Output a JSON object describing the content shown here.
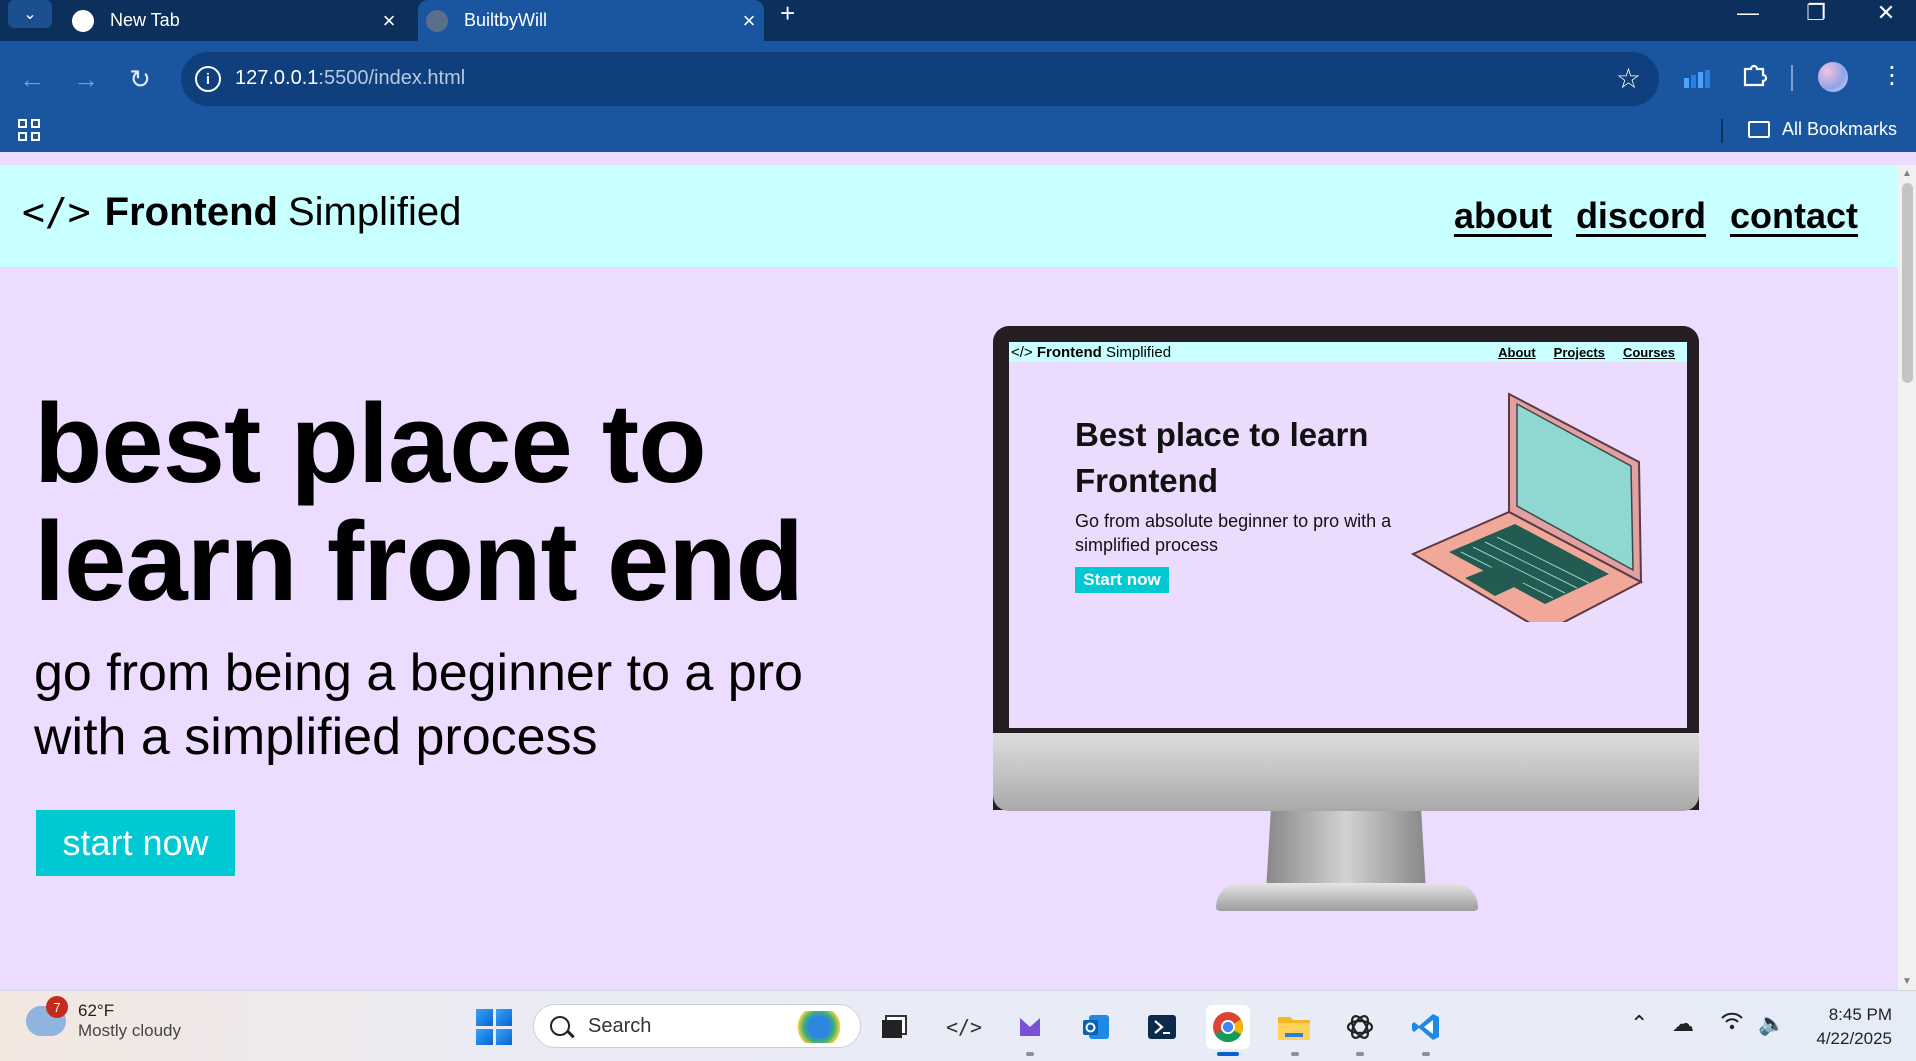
{
  "browser": {
    "tabs": [
      {
        "title": "New Tab"
      },
      {
        "title": "BuiltbyWill"
      }
    ],
    "url_host": "127.0.0.1",
    "url_path": ":5500/index.html",
    "bookmarks_label": "All Bookmarks"
  },
  "site": {
    "logo_code": "</>",
    "logo_bold": "Frontend",
    "logo_light": "Simplified",
    "nav": [
      "about",
      "discord",
      "contact"
    ],
    "hero_title": "best place to learn front end",
    "hero_subtitle": "go from being a beginner to a pro with a simplified process",
    "hero_button": "start now"
  },
  "illustration": {
    "logo_code": "</>",
    "logo_bold": "Frontend",
    "logo_light": "Simplified",
    "nav": [
      "About",
      "Projects",
      "Courses"
    ],
    "title": "Best place to learn Frontend",
    "subtitle": "Go from absolute beginner to pro with a simplified process",
    "button": "Start now"
  },
  "taskbar": {
    "weather_badge": "7",
    "temperature": "62°F",
    "condition": "Mostly cloudy",
    "search_placeholder": "Search",
    "time": "8:45 PM",
    "date": "4/22/2025"
  },
  "colors": {
    "chrome_dark": "#0c2f5c",
    "chrome_toolbar": "#1a56a0",
    "site_header": "#c8ffff",
    "site_background": "#ecdcff",
    "accent_button": "#00c9d3"
  }
}
